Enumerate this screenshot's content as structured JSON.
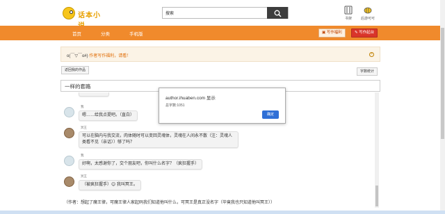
{
  "header": {
    "logo_text": "话本小说",
    "search_placeholder": "搜索",
    "shelf_label": "书架",
    "follow_label": "后游可可"
  },
  "nav": {
    "items": [
      "首页",
      "分类",
      "手机版"
    ],
    "write_welfare": "写作福利",
    "write_start": "写作起台"
  },
  "notice": {
    "face": "o(￣▽￣o#)",
    "text": "作者写作福利，请看！"
  },
  "buttons": {
    "back": "返回我的作品",
    "stats": "字数统计"
  },
  "story": {
    "title": "一样的套路"
  },
  "chat": {
    "messages": [
      {
        "speaker": "我",
        "text": "嗯……给我点提吧。（直白）"
      },
      {
        "speaker": "冥王",
        "text": "可以在脑内与我交流，肉体随时可以变回灵魂体，灵魂在人间永不散（注：灵魂人类看不见（亲话））够了吗？"
      },
      {
        "speaker": "我",
        "text": "好啊，太感谢你了，交个朋友吧，你叫什么名字？（疯狂握手）"
      },
      {
        "speaker": "冥王",
        "text": "（被疯狂握手）😊 我叫冥王。"
      }
    ],
    "narration": "（作者：想起了魔王律，可魔王律人家起码我们知道他叫什么，可冥王是真正没名字（毕竟我也只知道他叫冥王））"
  },
  "dialog": {
    "title": "author.ihuaben.com 显示",
    "message": "总字数:1051",
    "ok": "确定"
  },
  "colors": {
    "nav_bg": "#f08a2c",
    "notice_bg": "#fbf3e6",
    "ok_button": "#2f6fd6"
  }
}
